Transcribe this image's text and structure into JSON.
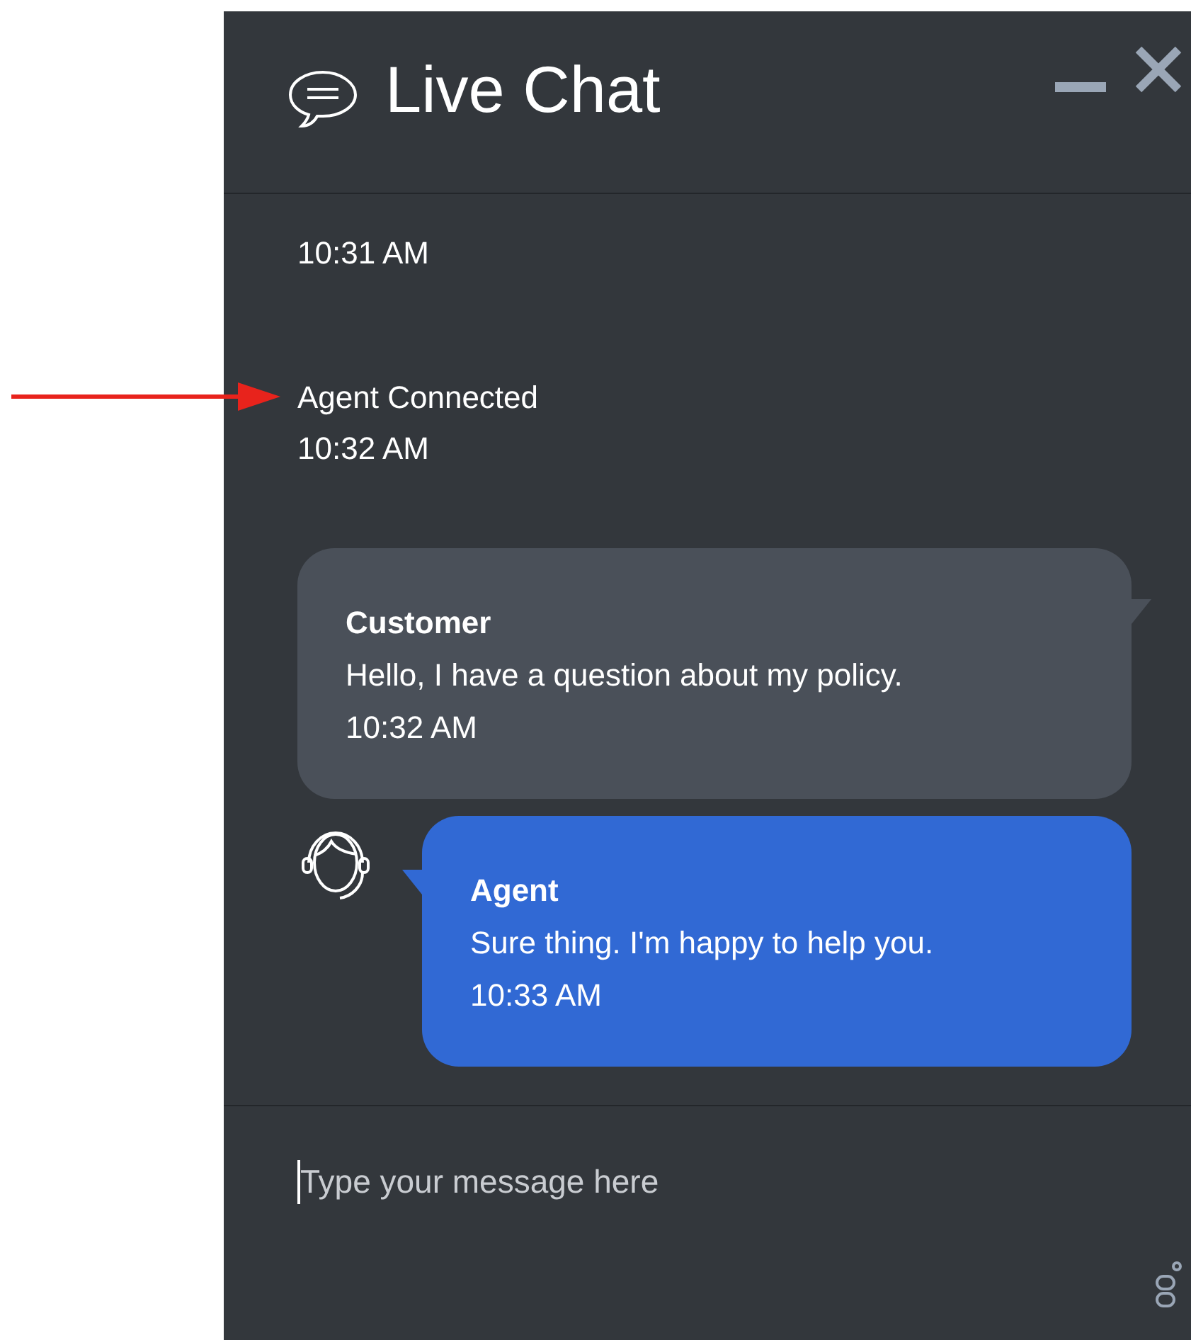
{
  "window": {
    "title": "Live Chat"
  },
  "events": [
    {
      "time": "10:31 AM",
      "highlighted": false
    },
    {
      "text": "Agent Connected",
      "time": "10:32 AM",
      "highlighted": true
    }
  ],
  "messages": [
    {
      "kind": "customer",
      "sender": "Customer",
      "text": "Hello, I have a question about my policy.",
      "time": "10:32 AM"
    },
    {
      "kind": "agent",
      "sender": "Agent",
      "text": "Sure thing. I'm happy to help you.",
      "time": "10:33 AM"
    }
  ],
  "input": {
    "placeholder": "Type your message here"
  }
}
